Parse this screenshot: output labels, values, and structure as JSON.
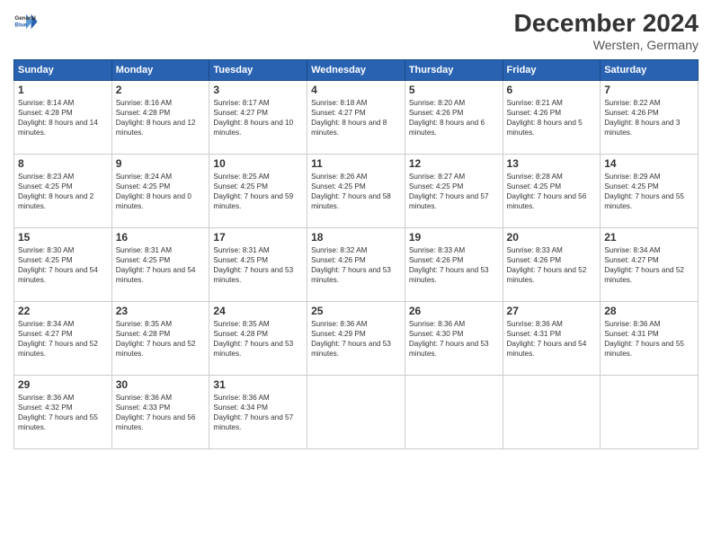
{
  "logo": {
    "line1": "General",
    "line2": "Blue"
  },
  "title": "December 2024",
  "subtitle": "Wersten, Germany",
  "days_header": [
    "Sunday",
    "Monday",
    "Tuesday",
    "Wednesday",
    "Thursday",
    "Friday",
    "Saturday"
  ],
  "weeks": [
    [
      {
        "day": "1",
        "sunrise": "Sunrise: 8:14 AM",
        "sunset": "Sunset: 4:28 PM",
        "daylight": "Daylight: 8 hours and 14 minutes."
      },
      {
        "day": "2",
        "sunrise": "Sunrise: 8:16 AM",
        "sunset": "Sunset: 4:28 PM",
        "daylight": "Daylight: 8 hours and 12 minutes."
      },
      {
        "day": "3",
        "sunrise": "Sunrise: 8:17 AM",
        "sunset": "Sunset: 4:27 PM",
        "daylight": "Daylight: 8 hours and 10 minutes."
      },
      {
        "day": "4",
        "sunrise": "Sunrise: 8:18 AM",
        "sunset": "Sunset: 4:27 PM",
        "daylight": "Daylight: 8 hours and 8 minutes."
      },
      {
        "day": "5",
        "sunrise": "Sunrise: 8:20 AM",
        "sunset": "Sunset: 4:26 PM",
        "daylight": "Daylight: 8 hours and 6 minutes."
      },
      {
        "day": "6",
        "sunrise": "Sunrise: 8:21 AM",
        "sunset": "Sunset: 4:26 PM",
        "daylight": "Daylight: 8 hours and 5 minutes."
      },
      {
        "day": "7",
        "sunrise": "Sunrise: 8:22 AM",
        "sunset": "Sunset: 4:26 PM",
        "daylight": "Daylight: 8 hours and 3 minutes."
      }
    ],
    [
      {
        "day": "8",
        "sunrise": "Sunrise: 8:23 AM",
        "sunset": "Sunset: 4:25 PM",
        "daylight": "Daylight: 8 hours and 2 minutes."
      },
      {
        "day": "9",
        "sunrise": "Sunrise: 8:24 AM",
        "sunset": "Sunset: 4:25 PM",
        "daylight": "Daylight: 8 hours and 0 minutes."
      },
      {
        "day": "10",
        "sunrise": "Sunrise: 8:25 AM",
        "sunset": "Sunset: 4:25 PM",
        "daylight": "Daylight: 7 hours and 59 minutes."
      },
      {
        "day": "11",
        "sunrise": "Sunrise: 8:26 AM",
        "sunset": "Sunset: 4:25 PM",
        "daylight": "Daylight: 7 hours and 58 minutes."
      },
      {
        "day": "12",
        "sunrise": "Sunrise: 8:27 AM",
        "sunset": "Sunset: 4:25 PM",
        "daylight": "Daylight: 7 hours and 57 minutes."
      },
      {
        "day": "13",
        "sunrise": "Sunrise: 8:28 AM",
        "sunset": "Sunset: 4:25 PM",
        "daylight": "Daylight: 7 hours and 56 minutes."
      },
      {
        "day": "14",
        "sunrise": "Sunrise: 8:29 AM",
        "sunset": "Sunset: 4:25 PM",
        "daylight": "Daylight: 7 hours and 55 minutes."
      }
    ],
    [
      {
        "day": "15",
        "sunrise": "Sunrise: 8:30 AM",
        "sunset": "Sunset: 4:25 PM",
        "daylight": "Daylight: 7 hours and 54 minutes."
      },
      {
        "day": "16",
        "sunrise": "Sunrise: 8:31 AM",
        "sunset": "Sunset: 4:25 PM",
        "daylight": "Daylight: 7 hours and 54 minutes."
      },
      {
        "day": "17",
        "sunrise": "Sunrise: 8:31 AM",
        "sunset": "Sunset: 4:25 PM",
        "daylight": "Daylight: 7 hours and 53 minutes."
      },
      {
        "day": "18",
        "sunrise": "Sunrise: 8:32 AM",
        "sunset": "Sunset: 4:26 PM",
        "daylight": "Daylight: 7 hours and 53 minutes."
      },
      {
        "day": "19",
        "sunrise": "Sunrise: 8:33 AM",
        "sunset": "Sunset: 4:26 PM",
        "daylight": "Daylight: 7 hours and 53 minutes."
      },
      {
        "day": "20",
        "sunrise": "Sunrise: 8:33 AM",
        "sunset": "Sunset: 4:26 PM",
        "daylight": "Daylight: 7 hours and 52 minutes."
      },
      {
        "day": "21",
        "sunrise": "Sunrise: 8:34 AM",
        "sunset": "Sunset: 4:27 PM",
        "daylight": "Daylight: 7 hours and 52 minutes."
      }
    ],
    [
      {
        "day": "22",
        "sunrise": "Sunrise: 8:34 AM",
        "sunset": "Sunset: 4:27 PM",
        "daylight": "Daylight: 7 hours and 52 minutes."
      },
      {
        "day": "23",
        "sunrise": "Sunrise: 8:35 AM",
        "sunset": "Sunset: 4:28 PM",
        "daylight": "Daylight: 7 hours and 52 minutes."
      },
      {
        "day": "24",
        "sunrise": "Sunrise: 8:35 AM",
        "sunset": "Sunset: 4:28 PM",
        "daylight": "Daylight: 7 hours and 53 minutes."
      },
      {
        "day": "25",
        "sunrise": "Sunrise: 8:36 AM",
        "sunset": "Sunset: 4:29 PM",
        "daylight": "Daylight: 7 hours and 53 minutes."
      },
      {
        "day": "26",
        "sunrise": "Sunrise: 8:36 AM",
        "sunset": "Sunset: 4:30 PM",
        "daylight": "Daylight: 7 hours and 53 minutes."
      },
      {
        "day": "27",
        "sunrise": "Sunrise: 8:36 AM",
        "sunset": "Sunset: 4:31 PM",
        "daylight": "Daylight: 7 hours and 54 minutes."
      },
      {
        "day": "28",
        "sunrise": "Sunrise: 8:36 AM",
        "sunset": "Sunset: 4:31 PM",
        "daylight": "Daylight: 7 hours and 55 minutes."
      }
    ],
    [
      {
        "day": "29",
        "sunrise": "Sunrise: 8:36 AM",
        "sunset": "Sunset: 4:32 PM",
        "daylight": "Daylight: 7 hours and 55 minutes."
      },
      {
        "day": "30",
        "sunrise": "Sunrise: 8:36 AM",
        "sunset": "Sunset: 4:33 PM",
        "daylight": "Daylight: 7 hours and 56 minutes."
      },
      {
        "day": "31",
        "sunrise": "Sunrise: 8:36 AM",
        "sunset": "Sunset: 4:34 PM",
        "daylight": "Daylight: 7 hours and 57 minutes."
      },
      null,
      null,
      null,
      null
    ]
  ]
}
